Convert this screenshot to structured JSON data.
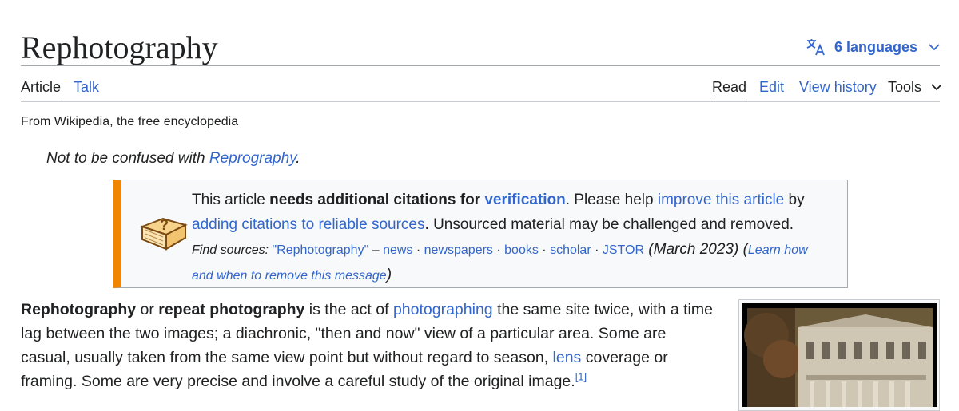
{
  "page": {
    "title": "Rephotography",
    "languages_label": "6 languages",
    "tagline": "From Wikipedia, the free encyclopedia"
  },
  "tabs": {
    "article": "Article",
    "talk": "Talk",
    "read": "Read",
    "edit": "Edit",
    "view_history": "View history",
    "tools": "Tools"
  },
  "hatnote": {
    "prefix": "Not to be confused with ",
    "link": "Reprography",
    "suffix": "."
  },
  "ambox": {
    "t1": "This article ",
    "bold": "needs additional citations for ",
    "link_verification": "verification",
    "t2": ". Please help ",
    "link_improve": "improve this article",
    "t3": " by",
    "link_adding": "adding citations to reliable sources",
    "t4": ". Unsourced material may be challenged and removed.",
    "find_sources": "Find sources: ",
    "src_query": "\"Rephotography\"",
    "dash": " – ",
    "src_news": "news",
    "sep": " · ",
    "src_newspapers": "newspapers",
    "src_books": "books",
    "src_scholar": "scholar",
    "src_jstor": "JSTOR",
    "date": " (March 2023)",
    "open_paren": " (",
    "link_learn": "Learn how and when to remove this message",
    "close_paren": ")"
  },
  "article": {
    "term1": "Rephotography",
    "or": " or ",
    "term2": "repeat photography",
    "t1": " is the act of ",
    "link_photographing": "photographing",
    "t2": " the same site twice, with a time lag between the two images; a diachronic, \"then and now\" view of a particular area. Some are casual, usually taken from the same view point but without regard to season, ",
    "link_lens": "lens",
    "t3": " coverage or framing. Some are very precise and involve a careful study of the original image.",
    "ref": "[1]"
  },
  "colors": {
    "link": "#3366cc",
    "text": "#202122",
    "ambox_stripe": "#f28500",
    "ambox_bg": "#f8f9fa"
  }
}
